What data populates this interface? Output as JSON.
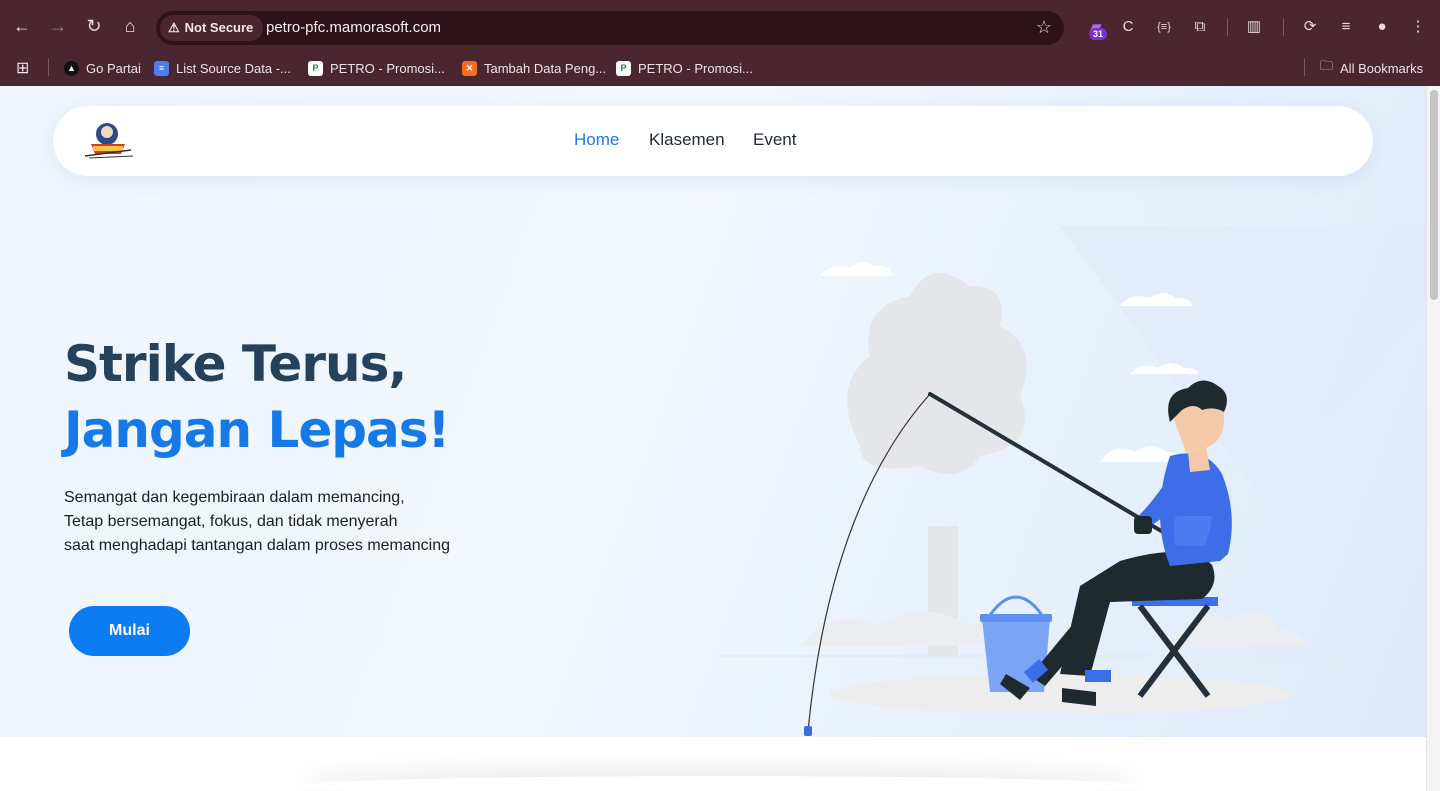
{
  "browser": {
    "security_label": "Not Secure",
    "url": "petro-pfc.mamorasoft.com",
    "extension_badge": "31",
    "bookmarks": [
      {
        "label": "Go Partai",
        "icon": "partai-favicon"
      },
      {
        "label": "List Source Data -...",
        "icon": "docs-favicon"
      },
      {
        "label": "PETRO - Promosi...",
        "icon": "petro-favicon"
      },
      {
        "label": "Tambah Data Peng...",
        "icon": "xampp-favicon"
      },
      {
        "label": "PETRO - Promosi...",
        "icon": "petro-favicon"
      }
    ],
    "all_bookmarks_label": "All Bookmarks"
  },
  "navbar": {
    "links": [
      {
        "label": "Home",
        "active": true
      },
      {
        "label": "Klasemen",
        "active": false
      },
      {
        "label": "Event",
        "active": false
      }
    ],
    "accent_color": "#1e78e6"
  },
  "hero": {
    "title_line1": "Strike Terus,",
    "title_line2": "Jangan Lepas!",
    "description_lines": [
      "Semangat dan kegembiraan dalam memancing,",
      "Tetap bersemangat, fokus, dan tidak menyerah",
      "saat menghadapi tantangan dalam proses memancing"
    ],
    "cta_label": "Mulai",
    "title_color": "#25415c",
    "title_accent_color": "#157ae8",
    "button_color": "#0d7bf2"
  }
}
